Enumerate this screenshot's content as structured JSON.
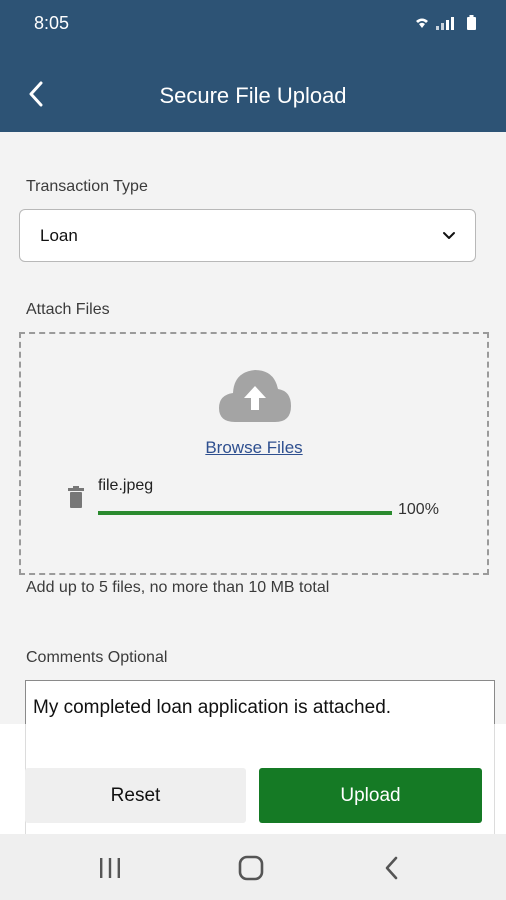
{
  "status_bar": {
    "time": "8:05"
  },
  "header": {
    "title": "Secure File Upload"
  },
  "form": {
    "transaction_type_label": "Transaction Type",
    "transaction_type_value": "Loan",
    "attach_label": "Attach Files",
    "browse_label": "Browse Files",
    "file": {
      "name": "file.jpeg",
      "progress_percent": 100,
      "progress_text": "100%"
    },
    "limit_hint": "Add up to 5 files, no more than 10 MB total",
    "comments_label": "Comments Optional",
    "comments_value": "My completed loan application is attached."
  },
  "actions": {
    "reset_label": "Reset",
    "upload_label": "Upload"
  },
  "colors": {
    "header": "#2d5375",
    "upload_button": "#157a25",
    "progress": "#2a8a2e",
    "link": "#2e4f8f"
  },
  "icons": [
    "back-arrow-icon",
    "chevron-down-icon",
    "cloud-upload-icon",
    "trash-icon",
    "nav-recents-icon",
    "nav-home-icon",
    "nav-back-icon",
    "wifi-icon",
    "signal-icon",
    "battery-icon"
  ]
}
